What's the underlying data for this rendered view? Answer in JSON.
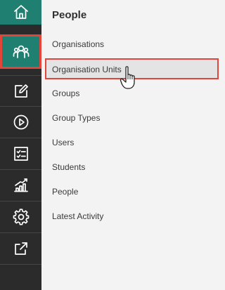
{
  "sidebar": {
    "buttons": [
      {
        "icon": "home-icon"
      },
      {
        "icon": "people-icon"
      },
      {
        "icon": "edit-icon"
      },
      {
        "icon": "play-icon"
      },
      {
        "icon": "checklist-icon"
      },
      {
        "icon": "chart-icon"
      },
      {
        "icon": "gear-icon"
      },
      {
        "icon": "export-icon"
      }
    ],
    "active": "people-icon"
  },
  "panel": {
    "title": "People",
    "items": [
      {
        "label": "Organisations"
      },
      {
        "label": "Organisation Units",
        "highlighted": true
      },
      {
        "label": "Groups"
      },
      {
        "label": "Group Types"
      },
      {
        "label": "Users"
      },
      {
        "label": "Students"
      },
      {
        "label": "People"
      },
      {
        "label": "Latest Activity"
      }
    ]
  },
  "colors": {
    "rail": "#2b2b2b",
    "accent": "#1f7f70",
    "highlight_border": "#e2463b"
  }
}
